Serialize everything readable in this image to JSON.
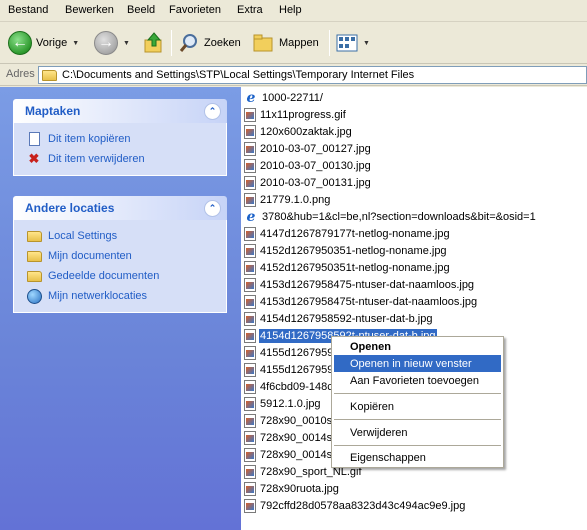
{
  "menubar": [
    "Bestand",
    "Bewerken",
    "Beeld",
    "Favorieten",
    "Extra",
    "Help"
  ],
  "toolbar": {
    "back_label": "Vorige",
    "search_label": "Zoeken",
    "folders_label": "Mappen"
  },
  "address": {
    "label": "Adres",
    "path": "C:\\Documents and Settings\\STP\\Local Settings\\Temporary Internet Files"
  },
  "tasks_panel": {
    "title": "Maptaken",
    "items": [
      "Dit item kopiëren",
      "Dit item verwijderen"
    ]
  },
  "locations_panel": {
    "title": "Andere locaties",
    "items": [
      "Local Settings",
      "Mijn documenten",
      "Gedeelde documenten",
      "Mijn netwerklocaties"
    ]
  },
  "files": [
    {
      "name": "1000-22711/",
      "icon": "ie-icon"
    },
    {
      "name": "11x11progress.gif",
      "icon": "image-file-icon"
    },
    {
      "name": "120x600zaktak.jpg",
      "icon": "image-file-icon"
    },
    {
      "name": "2010-03-07_00127.jpg",
      "icon": "image-file-icon"
    },
    {
      "name": "2010-03-07_00130.jpg",
      "icon": "image-file-icon"
    },
    {
      "name": "2010-03-07_00131.jpg",
      "icon": "image-file-icon"
    },
    {
      "name": "21779.1.0.png",
      "icon": "image-file-icon"
    },
    {
      "name": "3780&hub=1&cl=be,nl?section=downloads&bit=&osid=1",
      "icon": "ie-icon"
    },
    {
      "name": "4147d1267879177t-netlog-noname.jpg",
      "icon": "image-file-icon"
    },
    {
      "name": "4152d1267950351-netlog-noname.jpg",
      "icon": "image-file-icon"
    },
    {
      "name": "4152d1267950351t-netlog-noname.jpg",
      "icon": "image-file-icon"
    },
    {
      "name": "4153d1267958475-ntuser-dat-naamloos.jpg",
      "icon": "image-file-icon"
    },
    {
      "name": "4153d1267958475t-ntuser-dat-naamloos.jpg",
      "icon": "image-file-icon"
    },
    {
      "name": "4154d1267958592-ntuser-dat-b.jpg",
      "icon": "image-file-icon"
    },
    {
      "name": "4154d1267958592t-ntuser-dat-b.jpg",
      "icon": "image-file-icon",
      "selected": true
    },
    {
      "name": "4155d1267959",
      "icon": "image-file-icon"
    },
    {
      "name": "4155d1267959",
      "icon": "image-file-icon"
    },
    {
      "name": "4f6cbd09-148c",
      "icon": "image-file-icon"
    },
    {
      "name": "5912.1.0.jpg",
      "icon": "image-file-icon"
    },
    {
      "name": "728x90_0010s",
      "icon": "image-file-icon"
    },
    {
      "name": "728x90_0014s",
      "icon": "image-file-icon"
    },
    {
      "name": "728x90_0014s",
      "icon": "image-file-icon"
    },
    {
      "name": "728x90_sport_NL.gif",
      "icon": "image-file-icon"
    },
    {
      "name": "728x90ruota.jpg",
      "icon": "image-file-icon"
    },
    {
      "name": "792cffd28d0578aa8323d43c494ac9e9.jpg",
      "icon": "image-file-icon"
    }
  ],
  "context_menu": {
    "items": [
      "Openen",
      "Openen in nieuw venster",
      "Aan Favorieten toevoegen",
      "Kopiëren",
      "Verwijderen",
      "Eigenschappen"
    ],
    "highlighted": "Openen in nieuw venster"
  },
  "colors": {
    "selection": "#316ac5",
    "task_link": "#215dc6",
    "task_pane": "#6a84d8"
  }
}
